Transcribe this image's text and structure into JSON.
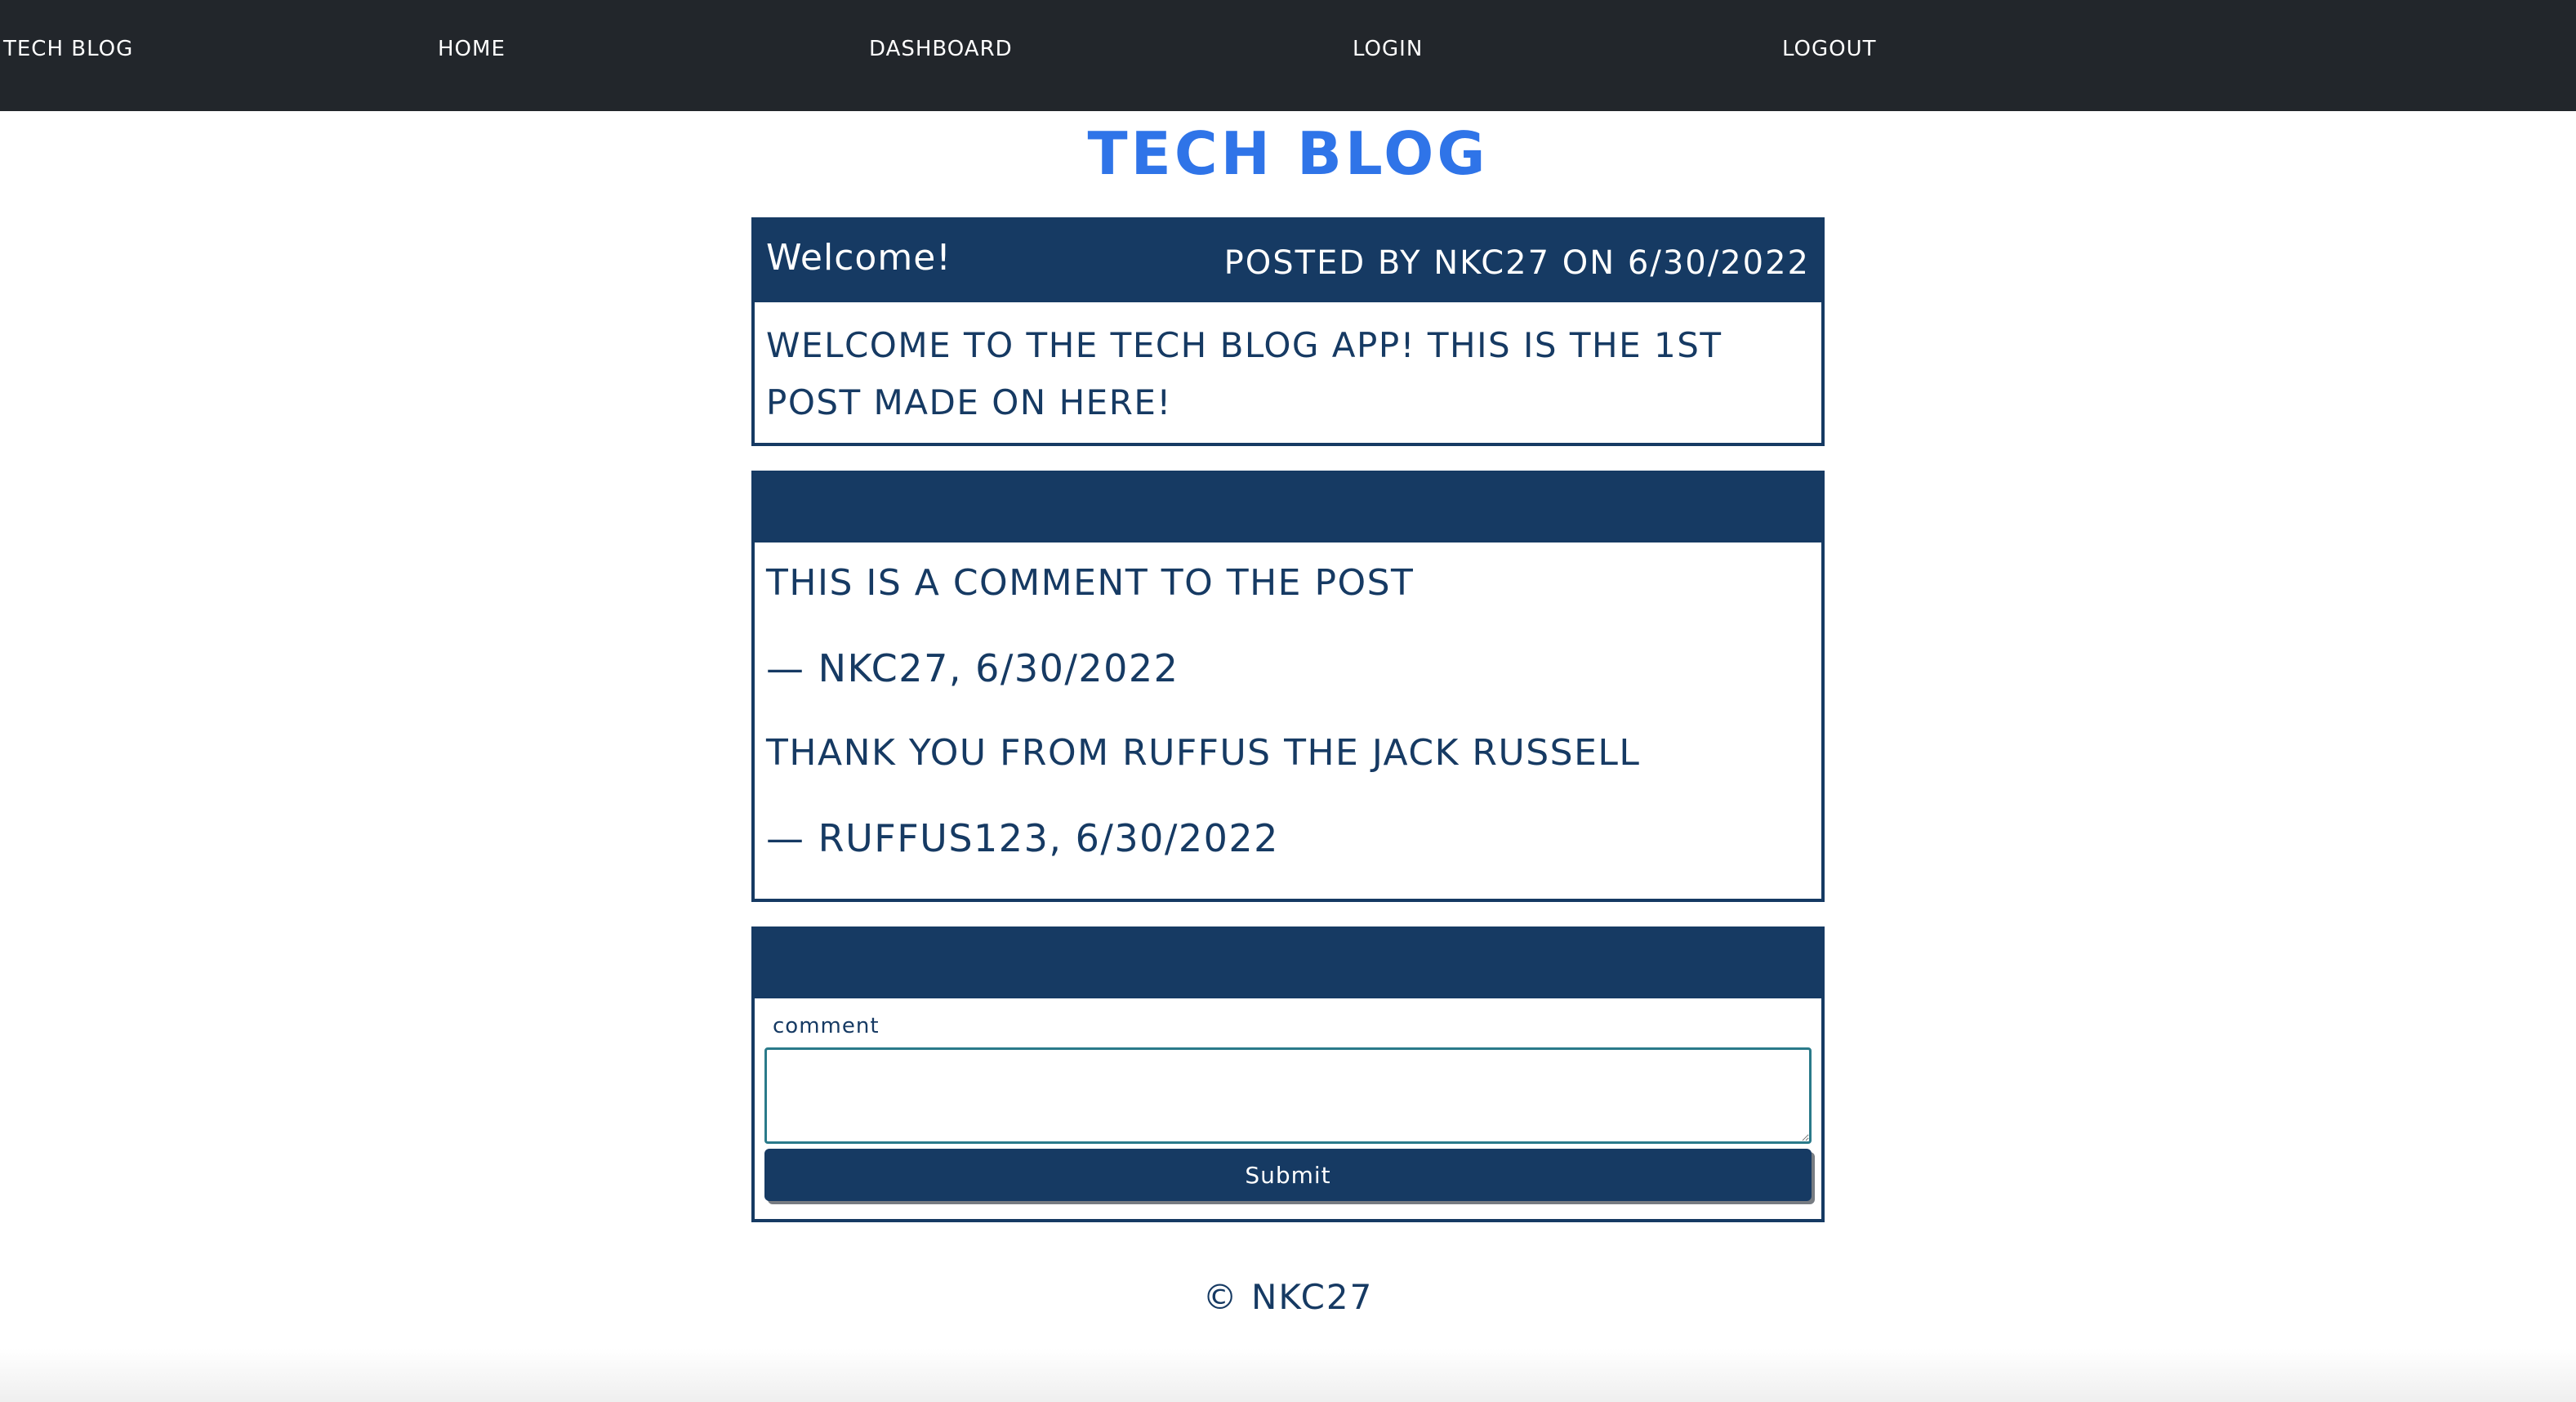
{
  "nav": {
    "brand": "Tech Blog",
    "home": "Home",
    "dashboard": "Dashboard",
    "login": "Login",
    "logout": "Logout"
  },
  "site_title": "Tech Blog",
  "post": {
    "title": "Welcome!",
    "meta": "Posted by NKC27 on 6/30/2022",
    "body": "Welcome to the Tech Blog App! This is the 1st post made on here!"
  },
  "comments": [
    {
      "text": "This is a comment to the post",
      "attribution": "— NKC27, 6/30/2022"
    },
    {
      "text": "Thank you from Ruffus the Jack Russell",
      "attribution": "— ruffus123, 6/30/2022"
    }
  ],
  "comment_form": {
    "label": "comment",
    "input_value": "",
    "submit_label": "Submit"
  },
  "footer": {
    "text": "© NKC27"
  },
  "colors": {
    "navbar": "#22262b",
    "accent_title": "#2f74e8",
    "card_navy": "#163a63"
  }
}
